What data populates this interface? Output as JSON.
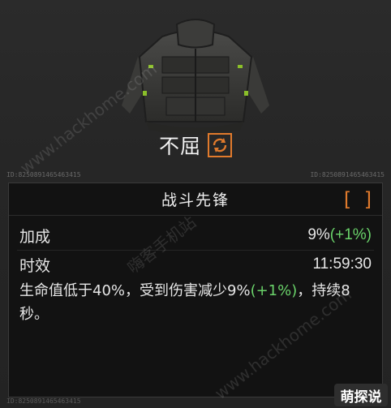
{
  "item": {
    "name": "不屈",
    "swap_icon": "refresh-icon",
    "id_left": "ID:8250891465463415",
    "id_right": "ID:8250891465463415",
    "id_bottom": "ID:8250891465463415"
  },
  "talent": {
    "title": "战斗先锋",
    "info_icon": "info-icon",
    "rows": [
      {
        "label": "加成",
        "value_main": "9%",
        "value_bonus": "(+1%)"
      },
      {
        "label": "时效",
        "value_main": "11:59:30",
        "value_bonus": ""
      }
    ],
    "desc_part1": "生命值低于40%，受到伤害减少9%",
    "desc_bonus": "(+1%)",
    "desc_part2": "，持续8秒。"
  },
  "watermarks": {
    "site": "www.hackhome.com",
    "site2": "www.hackhome.com",
    "cn": "嗨客手机站"
  },
  "corner_logo": "萌探说",
  "colors": {
    "accent": "#e07a2c",
    "bonus": "#6ad36a",
    "panel_bg": "#121212"
  }
}
